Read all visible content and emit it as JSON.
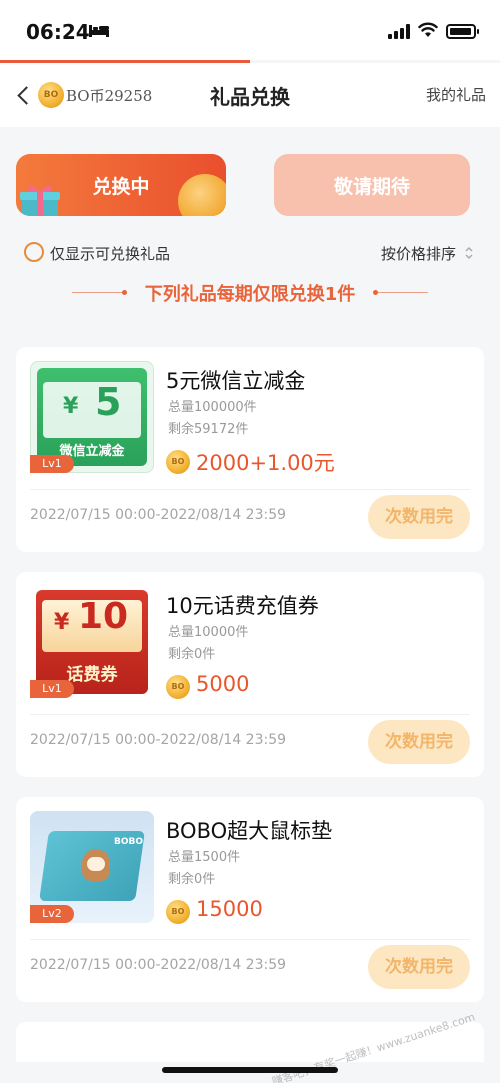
{
  "status_bar": {
    "time": "06:24"
  },
  "nav": {
    "coin_label": "BO",
    "balance": "BO币29258",
    "title": "礼品兑换",
    "right_link": "我的礼品"
  },
  "tabs": [
    {
      "label": "兑换中",
      "active": true
    },
    {
      "label": "敬请期待",
      "active": false
    }
  ],
  "filter": {
    "label": "仅显示可兑换礼品",
    "sort_label": "按价格排序"
  },
  "notice": "下列礼品每期仅限兑换1件",
  "items": [
    {
      "title": "5元微信立减金",
      "total": "总量100000件",
      "remaining": "剩余59172件",
      "price": "2000+1.00元",
      "level": "Lv1",
      "period": "2022/07/15 00:00-2022/08/14 23:59",
      "action": "次数用完",
      "thumb_amount": "5",
      "thumb_currency": "¥",
      "thumb_caption": "微信立减金"
    },
    {
      "title": "10元话费充值券",
      "total": "总量10000件",
      "remaining": "剩余0件",
      "price": "5000",
      "level": "Lv1",
      "period": "2022/07/15 00:00-2022/08/14 23:59",
      "action": "次数用完",
      "thumb_amount": "10",
      "thumb_currency": "¥",
      "thumb_caption": "话费券"
    },
    {
      "title": "BOBO超大鼠标垫",
      "total": "总量1500件",
      "remaining": "剩余0件",
      "price": "15000",
      "level": "Lv2",
      "period": "2022/07/15 00:00-2022/08/14 23:59",
      "action": "次数用完",
      "thumb_logo": "BOBO"
    }
  ],
  "watermark": "赚客吧，有奖一起赚！www.zuanke8.com",
  "colors": {
    "accent": "#e8643a",
    "button_bg": "#fde7c2",
    "button_text": "#f2b56a"
  }
}
